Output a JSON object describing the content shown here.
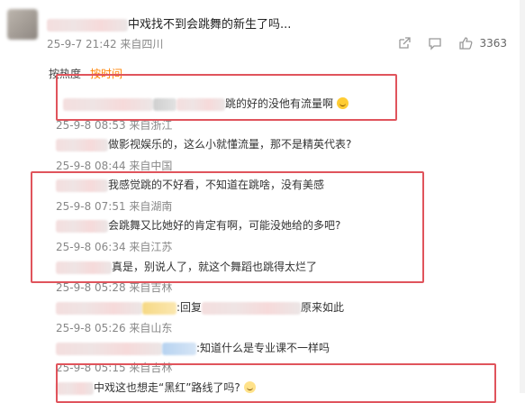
{
  "post": {
    "title": "中戏找不到会跳舞的新生了吗...",
    "meta": "25-9-7 21:42 来自四川",
    "like_count": "3363"
  },
  "sort": {
    "hot": "按热度",
    "time": "按时间"
  },
  "comments": [
    {
      "text": "跳的好的没他有流量啊",
      "meta": "25-9-8 08:53 来自浙江"
    },
    {
      "text": "做影视娱乐的，这么小就懂流量，那不是精英代表?",
      "meta": "25-9-8 08:44 来自中国"
    },
    {
      "text": "我感觉跳的不好看，不知道在跳啥，没有美感",
      "meta": "25-9-8 07:51 来自湖南"
    },
    {
      "text": "会跳舞又比她好的肯定有啊，可能没她给的多吧?",
      "meta": "25-9-8 06:34 来自江苏"
    },
    {
      "text": "真是，别说人了，就这个舞蹈也跳得太烂了",
      "meta": "25-9-8 05:28 来自吉林"
    },
    {
      "reply_prefix": ":回复",
      "text": "原来如此",
      "meta": "25-9-8 05:26 来自山东"
    },
    {
      "text": ":知道什么是专业课不一样吗",
      "meta": "25-9-8 05:15 来自吉林"
    },
    {
      "text": "中戏这也想走“黑红”路线了吗?"
    }
  ]
}
